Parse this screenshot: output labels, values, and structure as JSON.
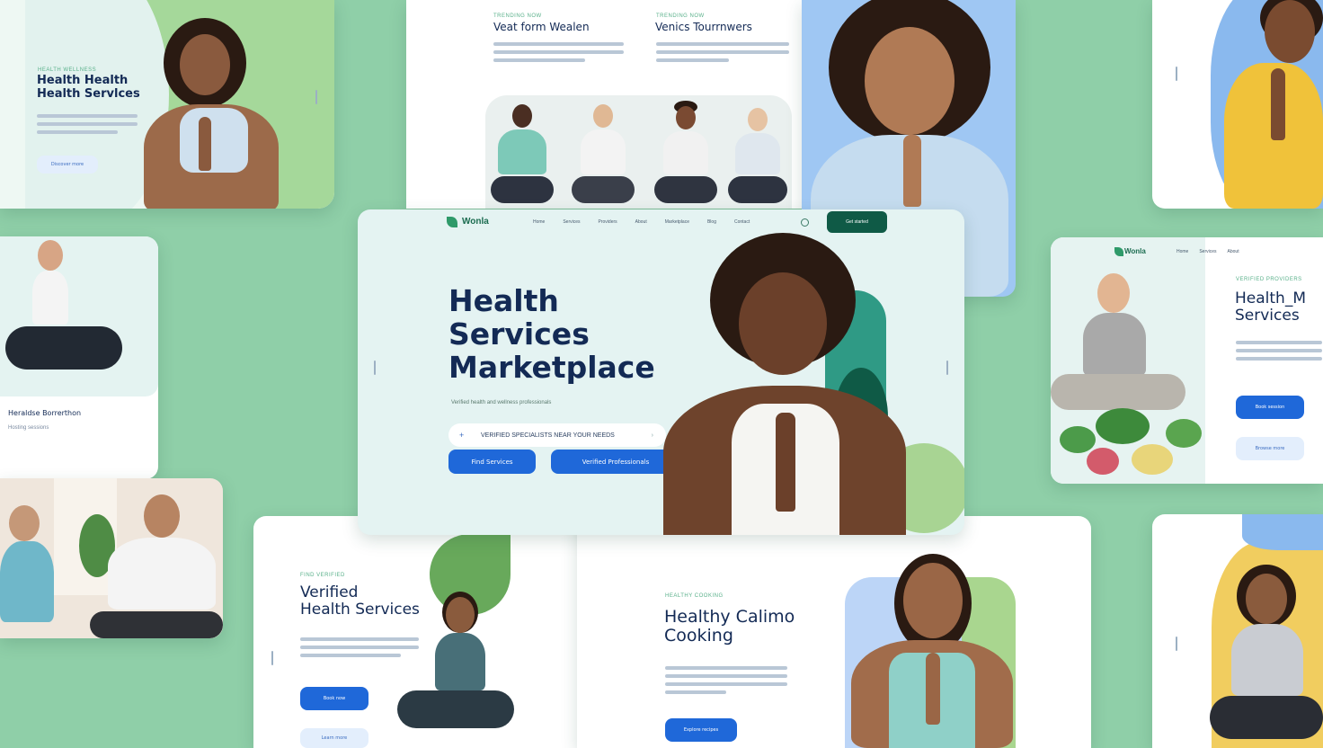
{
  "cards": {
    "top_left": {
      "eyebrow": "HEALTH WELLNESS",
      "title_line1": "Health Health",
      "title_line2": "Health Servlces",
      "button": "Discover more"
    },
    "top_middle": {
      "col1_eyebrow": "TRENDING NOW",
      "col1_title": "Veat form Wealen",
      "col2_eyebrow": "TRENDING NOW",
      "col2_title": "Venics Tourrnwers"
    },
    "mid_left": {
      "caption_title": "Heraldse Borrerthon",
      "caption_sub": "Hosting sessions"
    },
    "main": {
      "logo": "Wonla",
      "nav": [
        "Home",
        "Services",
        "Providers",
        "About",
        "Marketplace",
        "Blog",
        "Contact"
      ],
      "nav_cta": "Get started",
      "title_line1": "Health",
      "title_line2": "Services",
      "title_line3": "Marketplace",
      "subtitle": "Verified health and wellness professionals",
      "search_placeholder": "VERIFIED SPECIALISTS NEAR YOUR NEEDS",
      "btn_primary": "Find Services",
      "btn_secondary": "Verified Professionals"
    },
    "right_mid": {
      "logo": "Wonla",
      "nav": [
        "Home",
        "Services",
        "About"
      ],
      "eyebrow": "VERIFIED PROVIDERS",
      "title_line1": "Health_M",
      "title_line2": "Services",
      "btn_primary": "Book session",
      "btn_secondary": "Browse more"
    },
    "bottom_left": {
      "eyebrow": "FIND VERIFIED",
      "title_line1": "Verified",
      "title_line2": "Health Services",
      "btn_primary": "Book now",
      "btn_secondary": "Learn more"
    },
    "bottom_middle": {
      "eyebrow": "HEALTHY COOKING",
      "title_line1": "Healthy Calimo",
      "title_line2": "Cooking",
      "button": "Explore recipes"
    }
  },
  "colors": {
    "background": "#8fcfa8",
    "navy": "#132a55",
    "primary_blue": "#1f68d9",
    "deep_green": "#0f5a46"
  }
}
